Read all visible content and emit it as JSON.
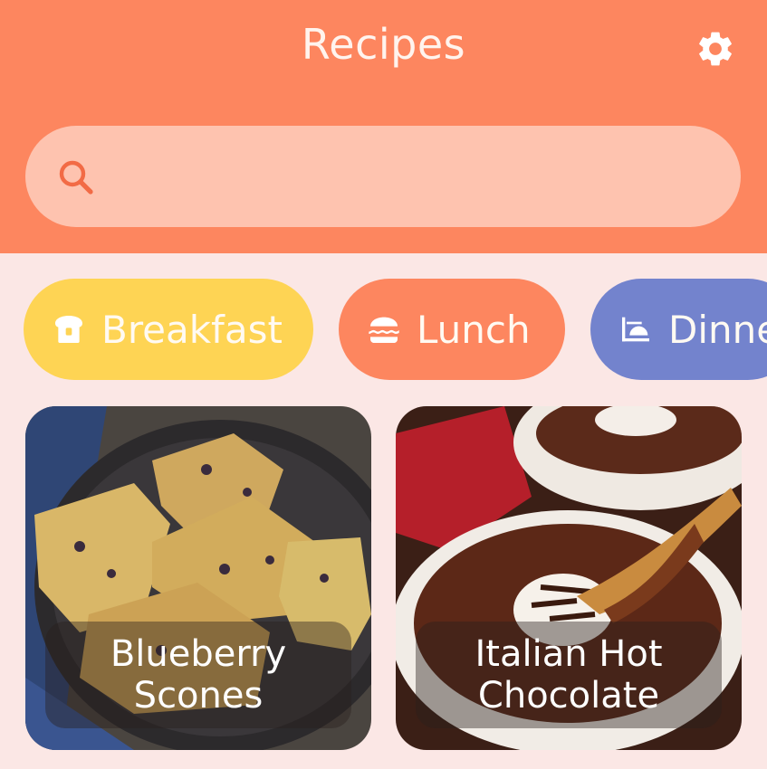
{
  "header": {
    "title": "Recipes",
    "settings_icon": "gear-icon",
    "background": "#fd865f"
  },
  "search": {
    "icon": "search-icon",
    "placeholder": "",
    "value": ""
  },
  "categories": [
    {
      "label": "Breakfast",
      "icon": "toast-icon",
      "color": "#fed454"
    },
    {
      "label": "Lunch",
      "icon": "burger-icon",
      "color": "#fd865f"
    },
    {
      "label": "Dinne",
      "icon": "dinner-icon",
      "color": "#7383cd"
    }
  ],
  "recipes": [
    {
      "title": "Blueberry Scones"
    },
    {
      "title": "Italian Hot Chocolate"
    }
  ]
}
